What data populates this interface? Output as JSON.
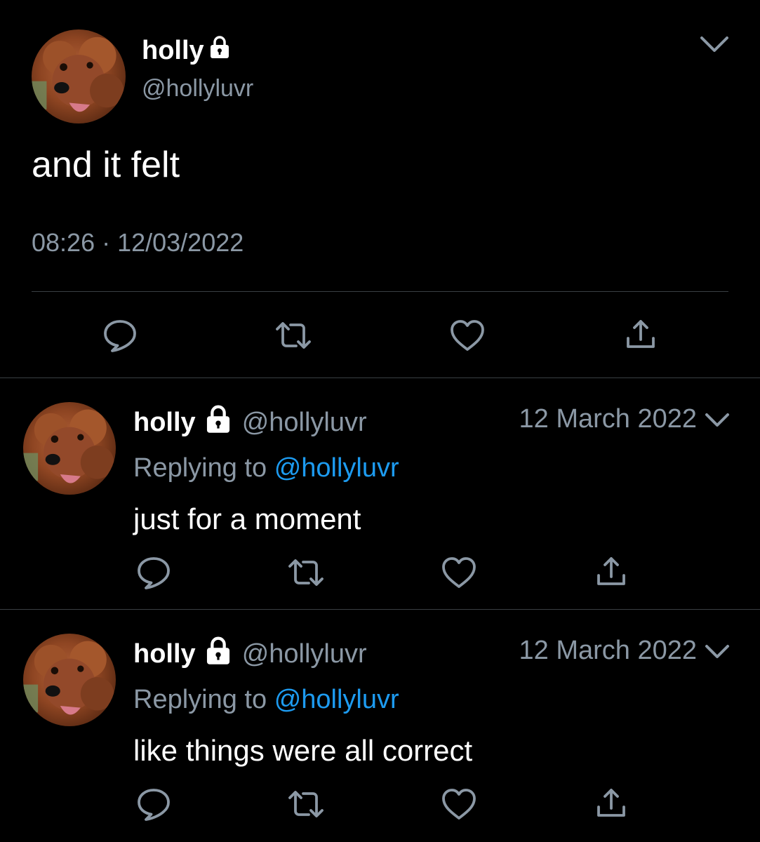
{
  "main_tweet": {
    "display_name": "holly",
    "handle": "@hollyluvr",
    "text": "and it felt",
    "time": "08:26",
    "separator": "·",
    "date": "12/03/2022",
    "icons": [
      "reply-icon",
      "retweet-icon",
      "like-icon",
      "share-icon"
    ]
  },
  "replies": [
    {
      "display_name": "holly",
      "handle": "@hollyluvr",
      "date": "12 March 2022",
      "replying_prefix": "Replying to",
      "replying_to": "@hollyluvr",
      "text": "just for a moment"
    },
    {
      "display_name": "holly",
      "handle": "@hollyluvr",
      "date": "12 March 2022",
      "replying_prefix": "Replying to",
      "replying_to": "@hollyluvr",
      "text": "like things were all correct"
    }
  ],
  "colors": {
    "background": "#000000",
    "primary_text": "#ffffff",
    "secondary_text": "#8b98a5",
    "link": "#1d9bf0",
    "divider": "#3a3f44"
  }
}
